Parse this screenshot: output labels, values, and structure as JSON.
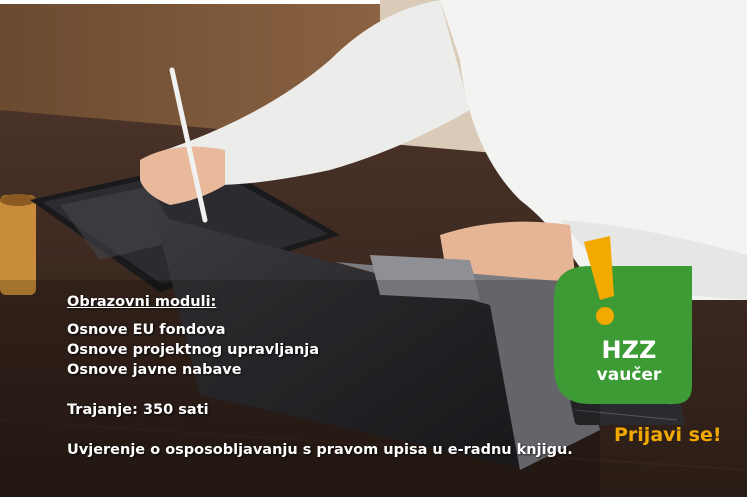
{
  "content": {
    "heading": "Obrazovni moduli:",
    "modules": [
      "Osnove EU fondova",
      "Osnove projektnog upravljanja",
      "Osnove javne nabave"
    ],
    "duration": "Trajanje: 350 sati",
    "certificate": "Uvjerenje o osposobljavanju s pravom upisa u e-radnu knjigu."
  },
  "badge": {
    "title": "HZZ",
    "subtitle": "vaučer",
    "color": "#3d9b35",
    "accent": "#f2a900",
    "icon": "exclamation-icon"
  },
  "cta": {
    "label": "Prijavi se!",
    "color": "#f2a900"
  }
}
